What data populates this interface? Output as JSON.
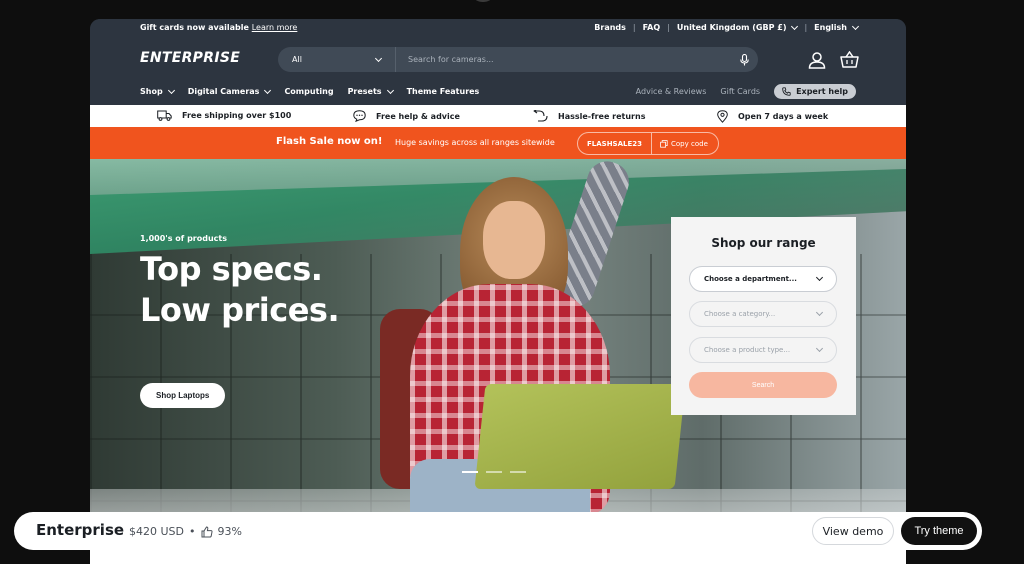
{
  "utility": {
    "gift_text": "Gift cards now available",
    "gift_link": "Learn more",
    "brands": "Brands",
    "faq": "FAQ",
    "region": "United Kingdom (GBP £)",
    "language": "English"
  },
  "header": {
    "logo": "ENTERPRISE",
    "search_category": "All",
    "search_placeholder": "Search for cameras..."
  },
  "nav": {
    "left": [
      "Shop",
      "Digital Cameras",
      "Computing",
      "Presets",
      "Theme Features"
    ],
    "right": [
      "Advice & Reviews",
      "Gift Cards"
    ],
    "expert": "Expert help"
  },
  "usp": [
    "Free shipping over $100",
    "Free help & advice",
    "Hassle-free returns",
    "Open 7 days a week"
  ],
  "flash": {
    "title": "Flash Sale now on!",
    "subtitle": "Huge savings across all ranges sitewide",
    "code": "FLASHSALE23",
    "copy": "Copy code"
  },
  "hero": {
    "eyebrow": "1,000's of products",
    "line1": "Top specs.",
    "line2": "Low prices.",
    "cta": "Shop Laptops"
  },
  "panel": {
    "title": "Shop our range",
    "department": "Choose a department...",
    "category": "Choose a category...",
    "product_type": "Choose a product type...",
    "search": "Search"
  },
  "bottom": {
    "name": "Enterprise",
    "price": "$420 USD",
    "rating": "93%",
    "view_demo": "View demo",
    "try_theme": "Try theme"
  },
  "colors": {
    "header_bg": "#2d3540",
    "flash_orange": "#f0541e",
    "search_button": "#f7b7a0"
  }
}
